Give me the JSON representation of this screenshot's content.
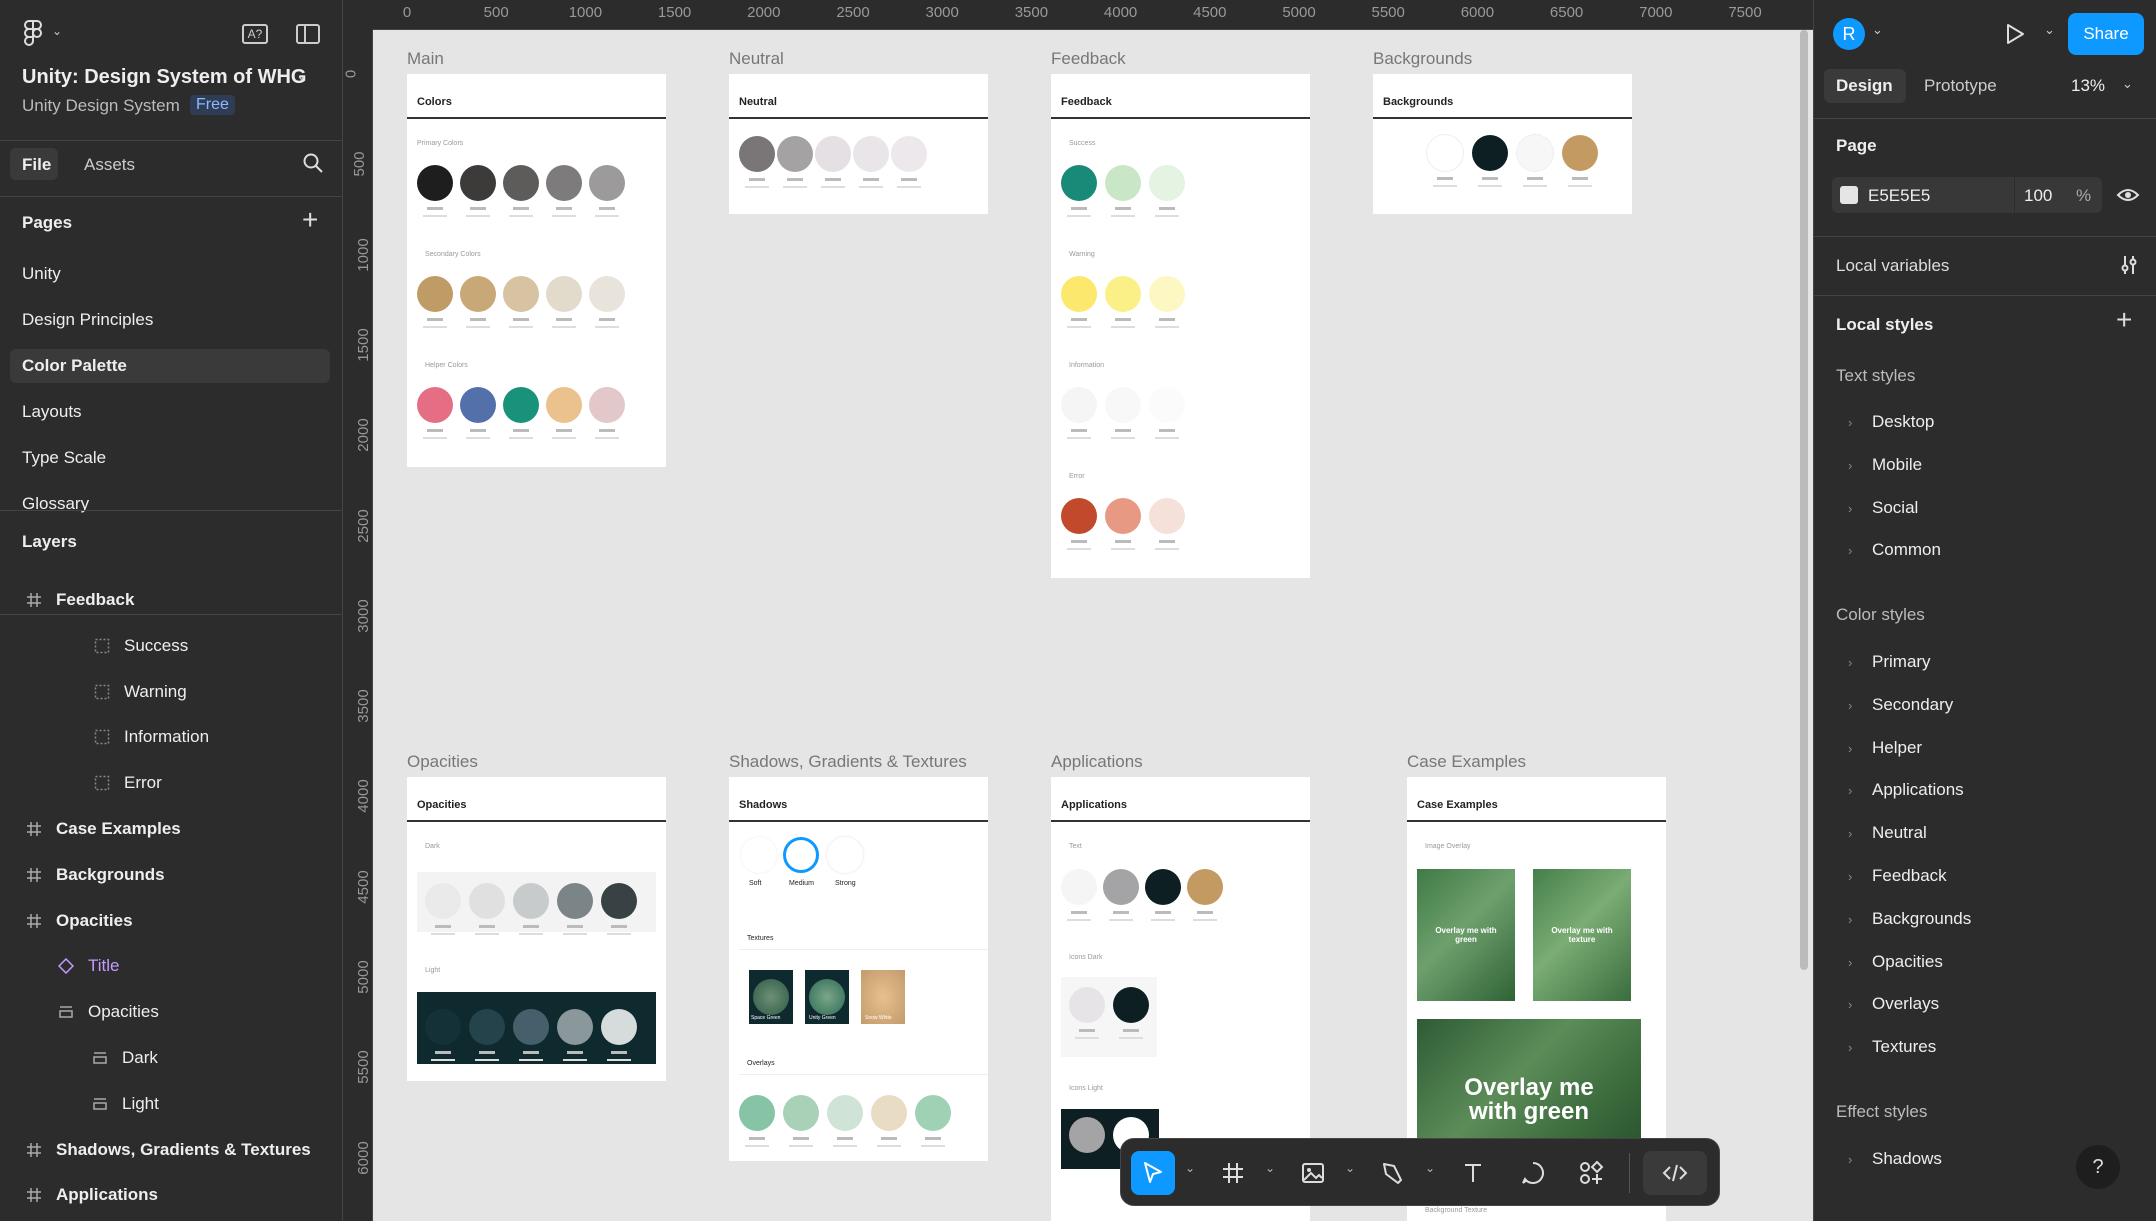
{
  "app": {
    "file_title": "Unity: Design System of WHG",
    "project": "Unity Design System",
    "plan_badge": "Free"
  },
  "left": {
    "tab_file": "File",
    "tab_assets": "Assets",
    "pages_heading": "Pages",
    "pages": [
      "Unity",
      "Design Principles",
      "Color Palette",
      "Layouts",
      "Type Scale",
      "Glossary"
    ],
    "layers_heading": "Layers",
    "layers": [
      {
        "name": "Feedback",
        "icon": "frame-icon",
        "bold": true
      },
      {
        "name": "Success",
        "icon": "section-icon",
        "bold": false
      },
      {
        "name": "Warning",
        "icon": "section-icon",
        "bold": false
      },
      {
        "name": "Information",
        "icon": "section-icon",
        "bold": false
      },
      {
        "name": "Error",
        "icon": "section-icon",
        "bold": false
      },
      {
        "name": "Case Examples",
        "icon": "frame-icon",
        "bold": true
      },
      {
        "name": "Backgrounds",
        "icon": "frame-icon",
        "bold": true
      },
      {
        "name": "Opacities",
        "icon": "frame-icon",
        "bold": true
      },
      {
        "name": "Title",
        "icon": "component-icon",
        "bold": false
      },
      {
        "name": "Opacities",
        "icon": "autolayout-icon",
        "bold": false
      },
      {
        "name": "Dark",
        "icon": "autolayout-icon",
        "bold": false
      },
      {
        "name": "Light",
        "icon": "autolayout-icon",
        "bold": false
      },
      {
        "name": "Shadows, Gradients & Textures",
        "icon": "frame-icon",
        "bold": true
      },
      {
        "name": "Applications",
        "icon": "frame-icon",
        "bold": true
      }
    ]
  },
  "ruler": {
    "x": [
      "0",
      "500",
      "1000",
      "1500",
      "2000",
      "2500",
      "3000",
      "3500",
      "4000",
      "4500",
      "5000",
      "5500",
      "6000",
      "6500",
      "7000",
      "7500"
    ],
    "y": [
      "0",
      "500",
      "1000",
      "1500",
      "2000",
      "2500",
      "3000",
      "3500",
      "4000",
      "4500",
      "5000",
      "5500",
      "6000"
    ]
  },
  "canvas": {
    "main": {
      "label": "Main",
      "head": "Colors",
      "g1": "Primary Colors",
      "g2": "Secondary Colors",
      "g3": "Helper Colors"
    },
    "neutral": {
      "label": "Neutral",
      "head": "Neutral"
    },
    "feedback": {
      "label": "Feedback",
      "head": "Feedback",
      "g1": "Success",
      "g2": "Warning",
      "g3": "Information",
      "g4": "Error"
    },
    "backgrounds": {
      "label": "Backgrounds",
      "head": "Backgrounds",
      "names": [
        "Primary",
        "Secondary",
        "Helper",
        "Alternative"
      ]
    },
    "opacities": {
      "label": "Opacities",
      "head": "Opacities",
      "g1": "Dark",
      "g2": "Light"
    },
    "shadows": {
      "label": "Shadows, Gradients & Textures",
      "head": "Shadows",
      "g1": "Textures",
      "g2": "Overlays",
      "s1": "Soft",
      "s2": "Medium",
      "s3": "Strong",
      "t1": "Space Green",
      "t2": "Unity Green",
      "t3": "Snow White"
    },
    "applications": {
      "label": "Applications",
      "head": "Applications",
      "g1": "Text",
      "g2": "Icons Dark",
      "g3": "Icons Light"
    },
    "cases": {
      "label": "Case Examples",
      "head": "Case Examples",
      "g1": "Image Overlay",
      "card1": "Overlay me with green",
      "card2": "Overlay me with texture",
      "big": "Overlay me with green",
      "g2": "Background Texture"
    }
  },
  "right": {
    "avatar": "R",
    "share": "Share",
    "tab_design": "Design",
    "tab_prototype": "Prototype",
    "zoom": "13%",
    "page_heading": "Page",
    "page_color": "E5E5E5",
    "page_opacity": "100",
    "pct": "%",
    "local_variables": "Local variables",
    "local_styles": "Local styles",
    "text_styles": "Text styles",
    "text_items": [
      "Desktop",
      "Mobile",
      "Social",
      "Common"
    ],
    "color_styles": "Color styles",
    "color_items": [
      "Primary",
      "Secondary",
      "Helper",
      "Applications",
      "Neutral",
      "Feedback",
      "Backgrounds",
      "Opacities",
      "Overlays",
      "Textures"
    ],
    "effect_styles": "Effect styles",
    "effect_items": [
      "Shadows"
    ],
    "help": "?"
  },
  "colors": {
    "accent": "#0d99ff",
    "canvas": "#e5e5e5",
    "panel": "#2c2c2c"
  }
}
